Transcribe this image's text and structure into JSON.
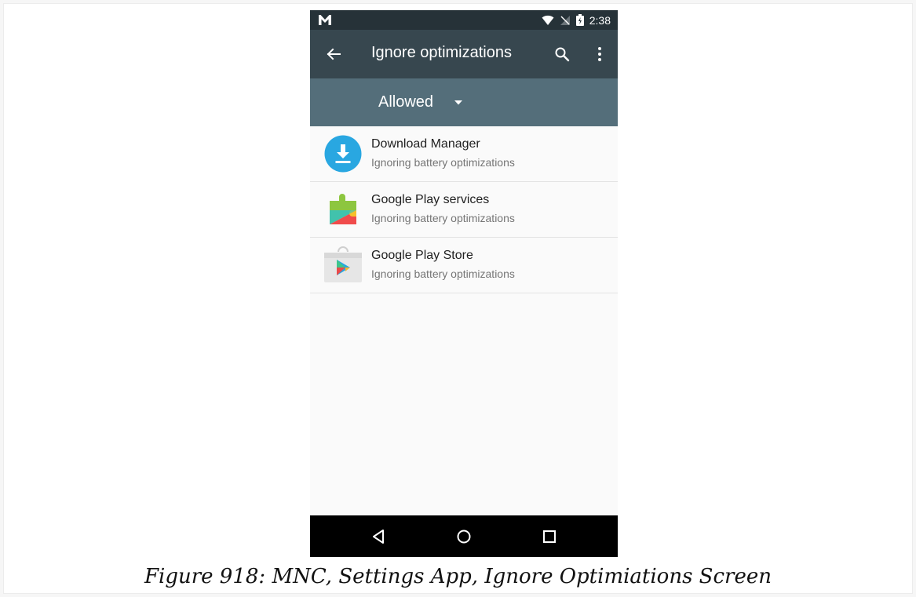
{
  "status_bar": {
    "left_icon": "gmail-icon",
    "time": "2:38",
    "icons": [
      "wifi-icon",
      "no-signal-icon",
      "battery-icon"
    ]
  },
  "toolbar": {
    "title": "Ignore optimizations",
    "back_icon": "back-arrow-icon",
    "search_icon": "search-icon",
    "more_icon": "more-vert-icon"
  },
  "filter": {
    "selected": "Allowed",
    "icon": "dropdown-arrow-icon"
  },
  "apps": [
    {
      "name": "Download Manager",
      "status": "Ignoring battery optimizations",
      "icon": "download-manager-icon"
    },
    {
      "name": "Google Play services",
      "status": "Ignoring battery optimizations",
      "icon": "play-services-icon"
    },
    {
      "name": "Google Play Store",
      "status": "Ignoring battery optimizations",
      "icon": "play-store-icon"
    }
  ],
  "nav_bar": {
    "buttons": [
      "back-triangle-icon",
      "home-circle-icon",
      "recents-square-icon"
    ]
  },
  "caption": "Figure 918: MNC, Settings App, Ignore Optimiations Screen",
  "colors": {
    "status_bar": "#263238",
    "toolbar": "#37474f",
    "filter_bar": "#546e7a",
    "accent_blue": "#29a7e1"
  }
}
